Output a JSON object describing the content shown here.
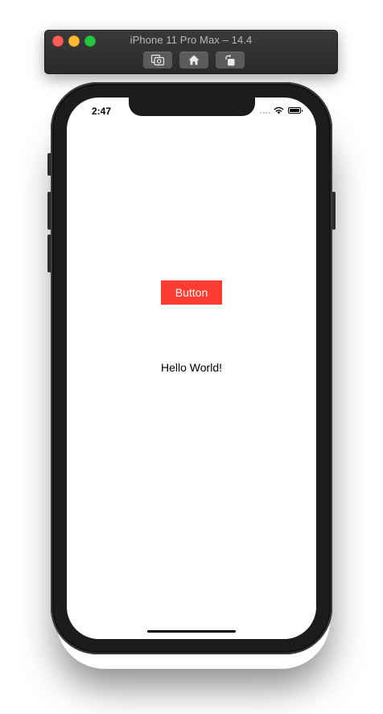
{
  "simulator": {
    "window_title": "iPhone 11 Pro Max – 14.4",
    "toolbar": [
      {
        "name": "screenshot",
        "icon": "camera-icon"
      },
      {
        "name": "home",
        "icon": "home-icon"
      },
      {
        "name": "rotate",
        "icon": "rotate-icon"
      }
    ],
    "traffic_lights": {
      "close": "#fe5f57",
      "minimize": "#febc2e",
      "zoom": "#28c840"
    }
  },
  "status_bar": {
    "time": "2:47",
    "icons": [
      "signal-icon",
      "wifi-icon",
      "battery-icon"
    ]
  },
  "app": {
    "button_label": "Button",
    "label_text": "Hello World!",
    "button_color": "#fd3b30"
  }
}
